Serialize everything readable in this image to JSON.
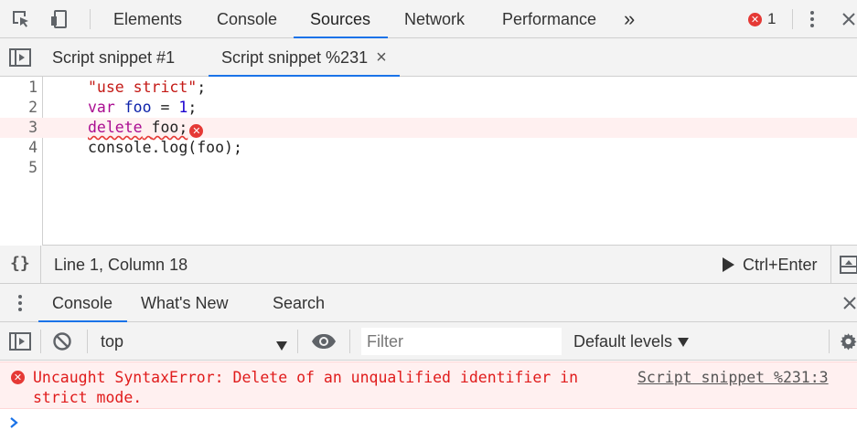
{
  "main_tabs": [
    {
      "label": "Elements"
    },
    {
      "label": "Console"
    },
    {
      "label": "Sources"
    },
    {
      "label": "Network"
    },
    {
      "label": "Performance"
    }
  ],
  "more_tabs_label": "»",
  "error_count": "1",
  "editor_tabs": [
    {
      "label": "Script snippet #1"
    },
    {
      "label": "Script snippet %231"
    }
  ],
  "close_glyph": "×",
  "code_lines": [
    {
      "number": "1"
    },
    {
      "number": "2"
    },
    {
      "number": "3"
    },
    {
      "number": "4"
    },
    {
      "number": "5"
    }
  ],
  "code": {
    "line1": "\"use strict\"",
    "line1_end": ";",
    "line2_kw": "var",
    "line2_var": "foo",
    "line2_eq": " = ",
    "line2_num": "1",
    "line2_end": ";",
    "line3_kw": "delete",
    "line3_var": "foo;",
    "line4": "console.log(foo);"
  },
  "status": {
    "format_icon": "{}",
    "position": "Line 1, Column 18",
    "run_label": "Ctrl+Enter"
  },
  "drawer_tabs": [
    {
      "label": "Console"
    },
    {
      "label": "What's New"
    },
    {
      "label": "Search"
    }
  ],
  "console_toolbar": {
    "context": "top",
    "filter_placeholder": "Filter",
    "levels": "Default levels"
  },
  "console_error": {
    "message": "Uncaught SyntaxError: Delete of an unqualified identifier in strict mode.",
    "source_link": "Script snippet %231:3"
  },
  "colors": {
    "accent": "#1a73e8",
    "error": "#e01b1b",
    "error_bg": "#fff0f0"
  }
}
